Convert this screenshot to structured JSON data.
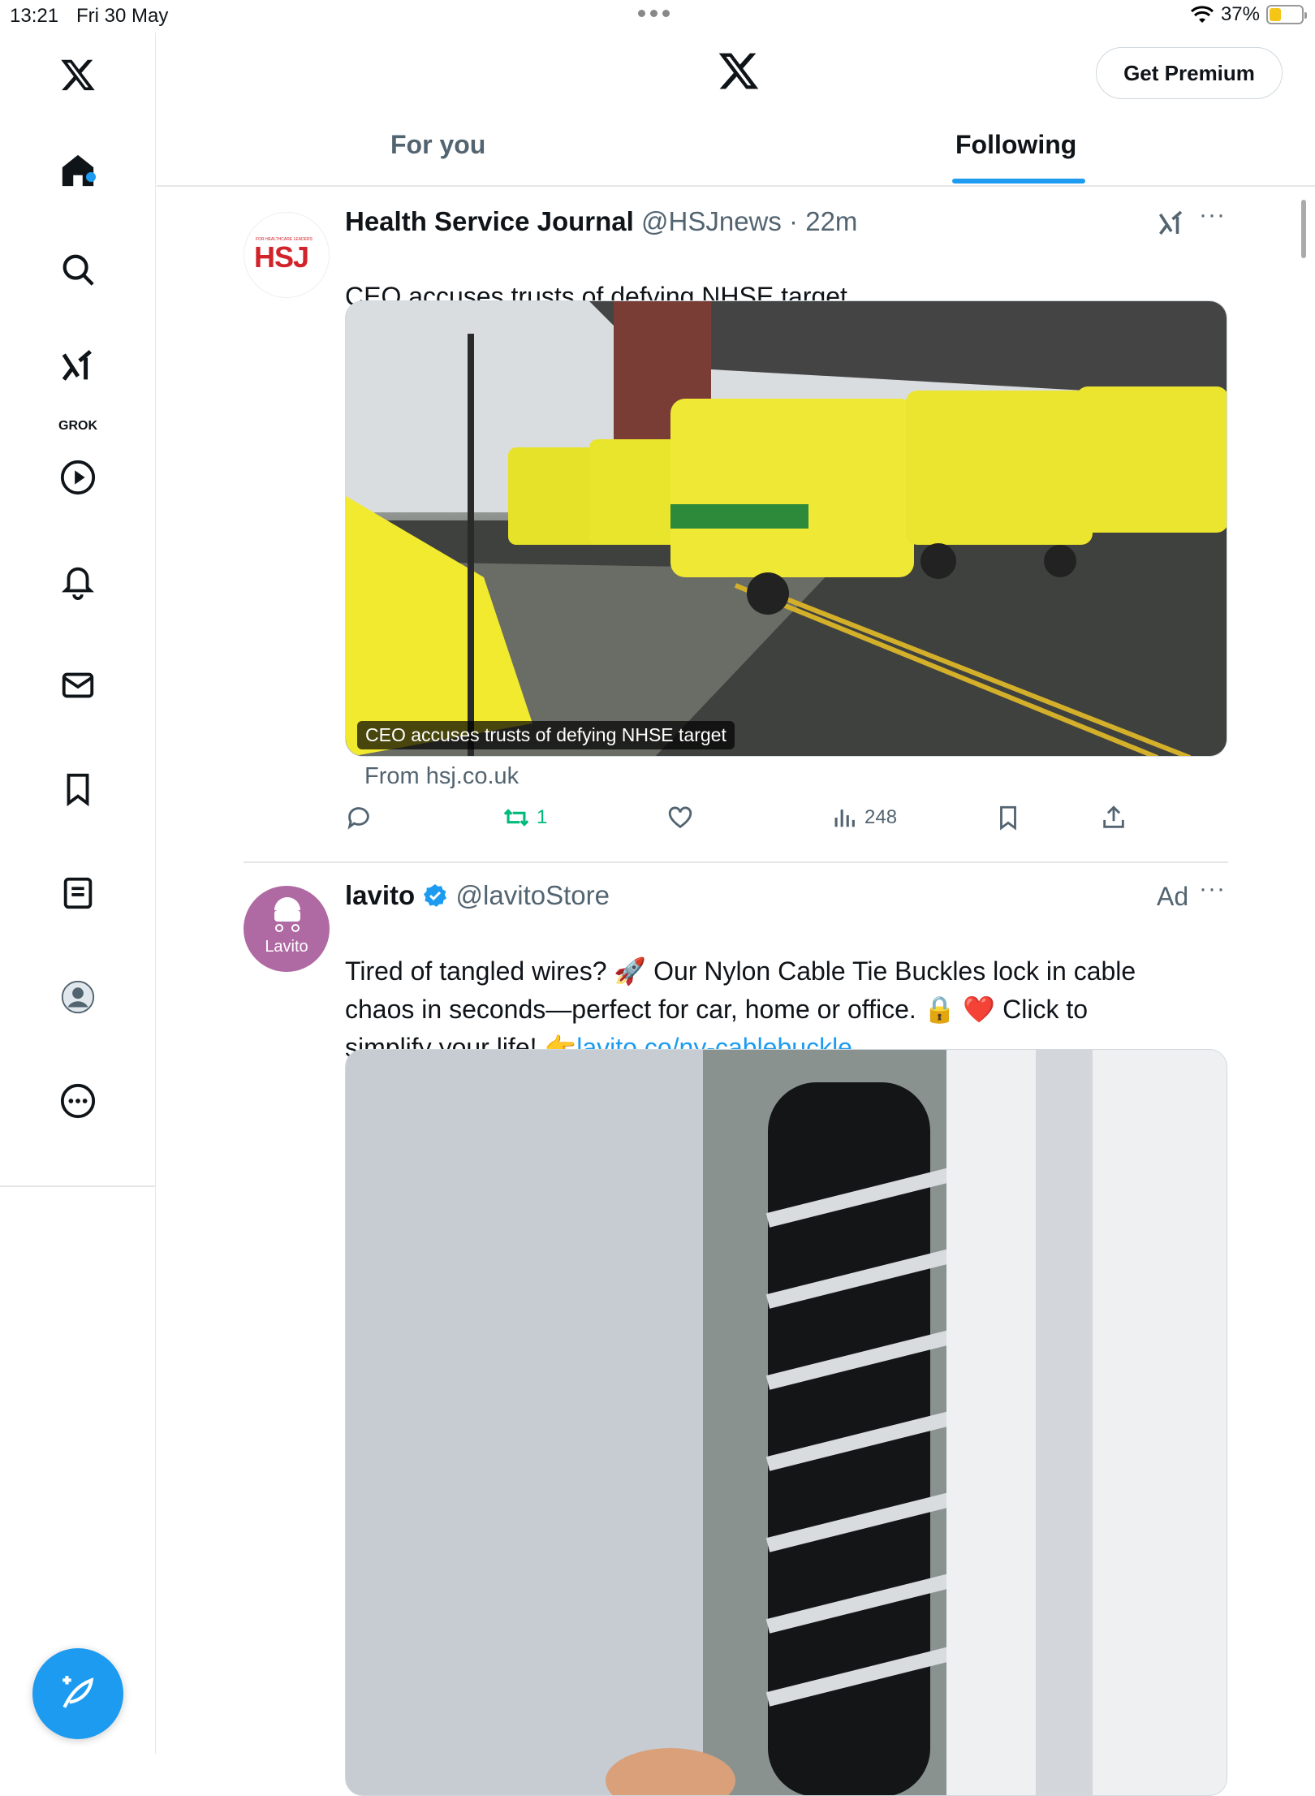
{
  "status_bar": {
    "time": "13:21",
    "date": "Fri 30 May",
    "battery": "37%"
  },
  "header": {
    "premium_label": "Get Premium",
    "tabs": [
      {
        "label": "For you"
      },
      {
        "label": "Following"
      }
    ]
  },
  "sidebar": {
    "grok_label": "GROK"
  },
  "posts": [
    {
      "name": "Health Service Journal",
      "handle": "@HSJnews",
      "time": "22m",
      "text": "CEO accuses trusts of defying NHSE target",
      "avatar_text": "HSJ",
      "avatar_small": "FOR HEALTHCARE LEADERS",
      "media_caption": "CEO accuses trusts of defying NHSE target",
      "link_source": "From hsj.co.uk",
      "reposts": "1",
      "views": "248"
    },
    {
      "name": "lavito",
      "handle": "@lavitoStore",
      "ad_label": "Ad",
      "avatar_text": "Lavito",
      "text_line1": "Tired of tangled wires? 🚀 Our Nylon Cable Tie Buckles lock in cable",
      "text_line2": "chaos in seconds—perfect for car, home or office. 🔒 ❤️ Click to",
      "text_line3": "simplify your life! 👉",
      "link": "lavito.co/ny-cablebuckle"
    }
  ],
  "colors": {
    "accent": "#1d9bf0",
    "repost": "#00ba7c",
    "muted": "#536471"
  }
}
